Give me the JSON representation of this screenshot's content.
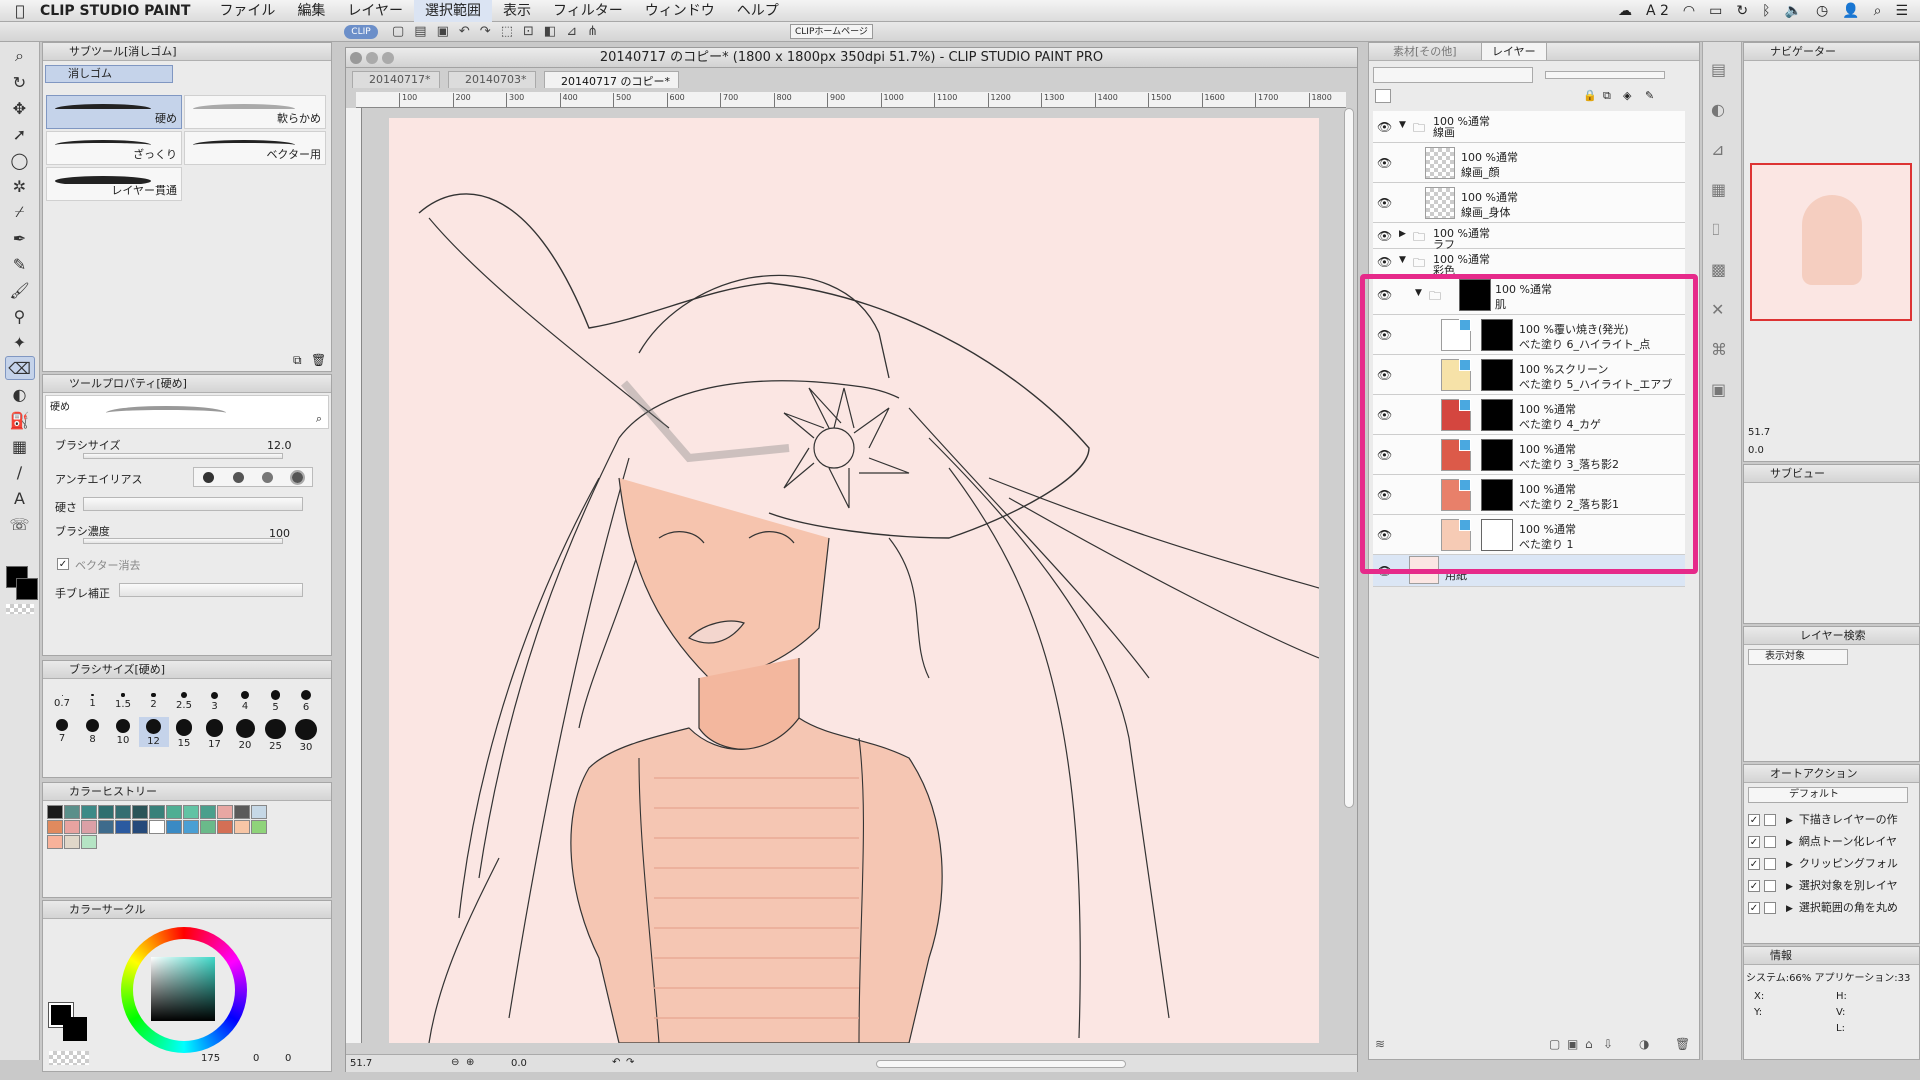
{
  "menubar": {
    "app_name": "CLIP STUDIO PAINT",
    "items": [
      "ファイル",
      "編集",
      "レイヤー",
      "選択範囲",
      "表示",
      "フィルター",
      "ウィンドウ",
      "ヘルプ"
    ],
    "active_item": "選択範囲",
    "status_icons": [
      "A 2"
    ]
  },
  "subtool_panel": {
    "title": "サブツール[消しゴム]",
    "group": "消しゴム",
    "brushes": [
      {
        "label": "硬め",
        "selected": true
      },
      {
        "label": "軟らかめ"
      },
      {
        "label": "ざっくり"
      },
      {
        "label": "ベクター用"
      },
      {
        "label": "レイヤー貫通"
      }
    ]
  },
  "tool_property": {
    "title": "ツールプロパティ[硬め]",
    "preset_name": "硬め",
    "brush_size_label": "ブラシサイズ",
    "brush_size_value": "12.0",
    "antialias_label": "アンチエイリアス",
    "hardness_label": "硬さ",
    "density_label": "ブラシ濃度",
    "density_value": "100",
    "vector_erase_label": "ベクター消去",
    "stabilization_label": "手ブレ補正"
  },
  "brush_size_panel": {
    "title": "ブラシサイズ[硬め]",
    "sizes": [
      "0.7",
      "1",
      "1.5",
      "2",
      "2.5",
      "3",
      "4",
      "5",
      "6",
      "7",
      "8",
      "10",
      "12",
      "15",
      "17",
      "20",
      "25",
      "30"
    ],
    "selected": "12"
  },
  "color_history": {
    "title": "カラーヒストリー",
    "swatches": [
      "#1a1a1a",
      "#5a8f8a",
      "#3c8a87",
      "#2f6f6f",
      "#346e71",
      "#2a5458",
      "#38817a",
      "#4fae93",
      "#62c3a4",
      "#4a9f8c",
      "#e8a7a3",
      "#5a5a5a",
      "#c6d8e6",
      "#e08a5e",
      "#e8a3a0",
      "#dba0a6",
      "#3e6b8c",
      "#2b5aa0",
      "#264a7a",
      "#ffffff",
      "#3a8ac4",
      "#4a9fd4",
      "#6aba8a",
      "#d46f55",
      "#f7c6a6",
      "#8fd47a",
      "#f8b29a",
      "#e0d7c9",
      "#b5e4c4"
    ]
  },
  "color_circle": {
    "title": "カラーサークル",
    "h_value": "175",
    "s_value": "0",
    "v_value": "0"
  },
  "document": {
    "window_title": "20140717 のコピー* (1800 x 1800px 350dpi 51.7%)  - CLIP STUDIO PAINT PRO",
    "tabs": [
      "20140717*",
      "20140703*",
      "20140717 のコピー*"
    ],
    "active_tab": 2,
    "ruler_ticks": [
      "100",
      "200",
      "300",
      "400",
      "500",
      "600",
      "700",
      "800",
      "900",
      "1000",
      "1100",
      "1200",
      "1300",
      "1400",
      "1500",
      "1600",
      "1700",
      "1800"
    ],
    "zoom": "51.7",
    "angle": "0.0",
    "home_button": "CLIPホームページ"
  },
  "layer_panel": {
    "tabs": [
      "素材[その他]",
      "レイヤー"
    ],
    "layers": [
      {
        "mode": "100 %通常",
        "name": "線画",
        "type": "folder",
        "indent": 0,
        "expanded": true
      },
      {
        "mode": "100 %通常",
        "name": "線画_顔",
        "type": "raster",
        "indent": 1
      },
      {
        "mode": "100 %通常",
        "name": "線画_身体",
        "type": "raster",
        "indent": 1
      },
      {
        "mode": "100 %通常",
        "name": "ラフ",
        "type": "folder",
        "indent": 0,
        "expanded": false
      },
      {
        "mode": "100 %通常",
        "name": "彩色",
        "type": "folder",
        "indent": 0,
        "expanded": true
      },
      {
        "mode": "100 %通常",
        "name": "肌",
        "type": "folder",
        "indent": 1,
        "expanded": true
      },
      {
        "mode": "100 %覆い焼き(発光)",
        "name": "べた塗り 6_ハイライト_点",
        "type": "fill",
        "color": "#ffffff",
        "indent": 2
      },
      {
        "mode": "100 %スクリーン",
        "name": "べた塗り 5_ハイライト_エアブ",
        "type": "fill",
        "color": "#f6e2a8",
        "indent": 2
      },
      {
        "mode": "100 %通常",
        "name": "べた塗り 4_カゲ",
        "type": "fill",
        "color": "#d4463f",
        "indent": 2
      },
      {
        "mode": "100 %通常",
        "name": "べた塗り 3_落ち影2",
        "type": "fill",
        "color": "#dc5a49",
        "indent": 2
      },
      {
        "mode": "100 %通常",
        "name": "べた塗り 2_落ち影1",
        "type": "fill",
        "color": "#e8806a",
        "indent": 2
      },
      {
        "mode": "100 %通常",
        "name": "べた塗り 1",
        "type": "fill",
        "color": "#f6cbb5",
        "indent": 2
      },
      {
        "mode": "",
        "name": "用紙",
        "type": "paper",
        "color": "#fbe6e3",
        "indent": 0
      }
    ]
  },
  "navigator": {
    "title": "ナビゲーター",
    "zoom": "51.7",
    "angle": "0.0"
  },
  "subview": {
    "title": "サブビュー"
  },
  "layer_search": {
    "title": "レイヤー検索",
    "filter": "表示対象"
  },
  "auto_action": {
    "title": "オートアクション",
    "set": "デフォルト",
    "items": [
      "下描きレイヤーの作",
      "網点トーン化レイヤ",
      "クリッピングフォル",
      "選択対象を別レイヤ",
      "選択範囲の角を丸め"
    ]
  },
  "info": {
    "title": "情報",
    "memory": "システム:66% アプリケーション:33",
    "labels": [
      "X:",
      "Y:",
      "H:",
      "V:",
      "L:"
    ]
  },
  "colors": {
    "highlight": "#e62a8a",
    "paper": "#fbe6e3",
    "selection": "#c5d3ea"
  }
}
